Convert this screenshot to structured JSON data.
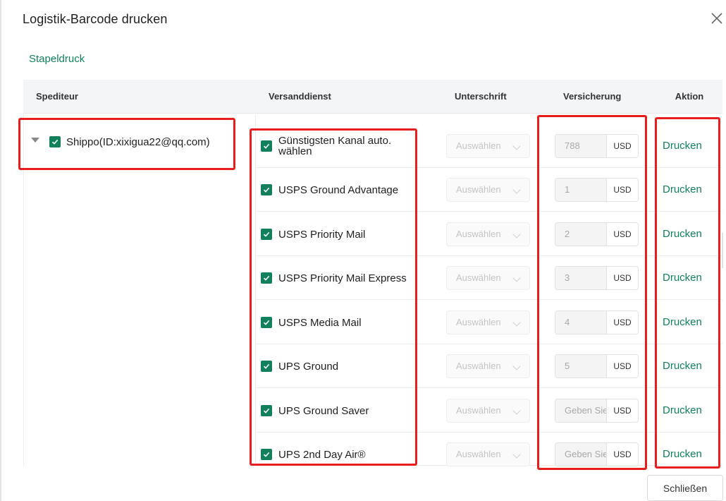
{
  "dialog": {
    "title": "Logistik-Barcode drucken",
    "batch_print": "Stapeldruck",
    "close_button": "Schließen"
  },
  "table": {
    "headers": {
      "carrier": "Spediteur",
      "service": "Versanddienst",
      "signature": "Unterschrift",
      "insurance": "Versicherung",
      "action": "Aktion"
    },
    "carrier": {
      "label": "Shippo(ID:xixigua22@qq.com)",
      "checked": true
    },
    "rows": [
      {
        "service": "Günstigsten Kanal auto. wählen",
        "signature": "Auswählen",
        "insurance": "788",
        "currency": "USD",
        "action": "Drucken"
      },
      {
        "service": "USPS Ground Advantage",
        "signature": "Auswählen",
        "insurance": "1",
        "currency": "USD",
        "action": "Drucken"
      },
      {
        "service": "USPS Priority Mail",
        "signature": "Auswählen",
        "insurance": "2",
        "currency": "USD",
        "action": "Drucken"
      },
      {
        "service": "USPS Priority Mail Express",
        "signature": "Auswählen",
        "insurance": "3",
        "currency": "USD",
        "action": "Drucken"
      },
      {
        "service": "USPS Media Mail",
        "signature": "Auswählen",
        "insurance": "4",
        "currency": "USD",
        "action": "Drucken"
      },
      {
        "service": "UPS Ground",
        "signature": "Auswählen",
        "insurance": "5",
        "currency": "USD",
        "action": "Drucken"
      },
      {
        "service": "UPS Ground Saver",
        "signature": "Auswählen",
        "insurance": "Geben Sie ein",
        "currency": "USD",
        "action": "Drucken"
      },
      {
        "service": "UPS 2nd Day Air®",
        "signature": "Auswählen",
        "insurance": "Geben Sie ein",
        "currency": "USD",
        "action": "Drucken"
      }
    ]
  },
  "colors": {
    "accent": "#12805c",
    "highlight": "#e81e1e"
  }
}
